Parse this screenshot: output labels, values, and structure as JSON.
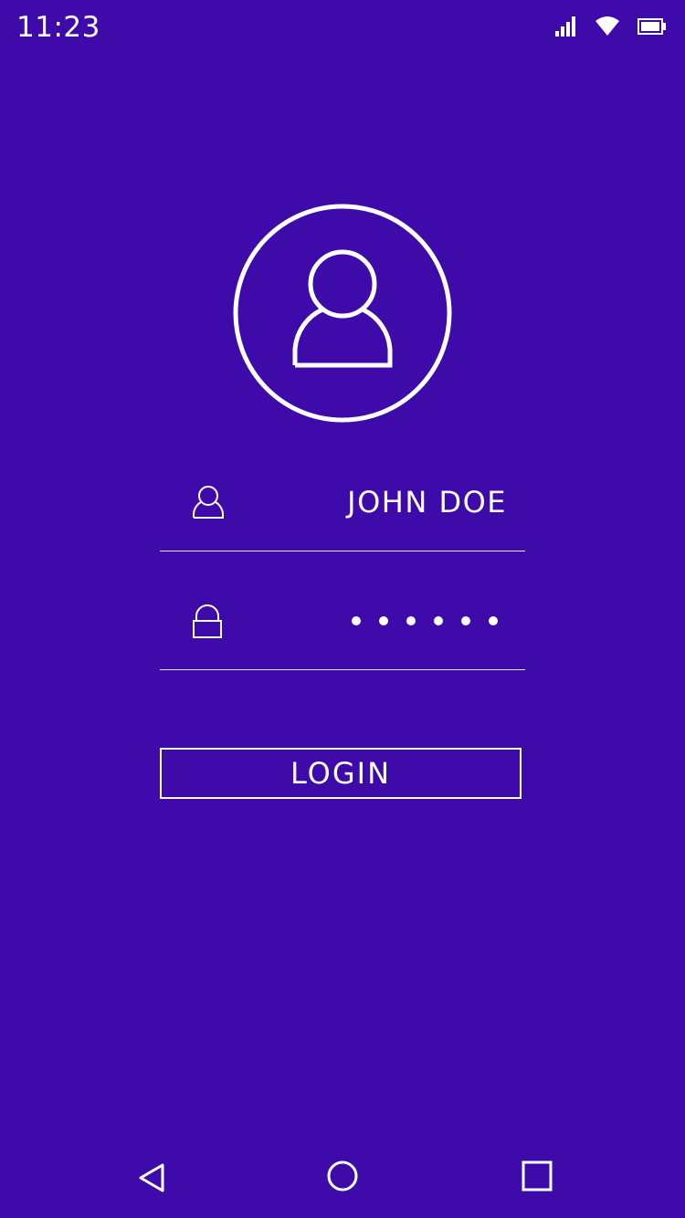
{
  "status_bar": {
    "time": "11:23",
    "icons": [
      "signal-icon",
      "wifi-icon",
      "battery-icon"
    ]
  },
  "avatar": {
    "icon": "user-avatar-icon"
  },
  "username_field": {
    "icon": "user-icon",
    "value": "JOHN DOE"
  },
  "password_field": {
    "icon": "lock-icon",
    "masked_length": 6
  },
  "login_button": {
    "label": "LOGIN"
  },
  "nav_bar": {
    "buttons": [
      "back-icon",
      "home-icon",
      "recents-icon"
    ]
  },
  "colors": {
    "background": "#3F0AAA",
    "foreground": "#FFFFFF"
  }
}
